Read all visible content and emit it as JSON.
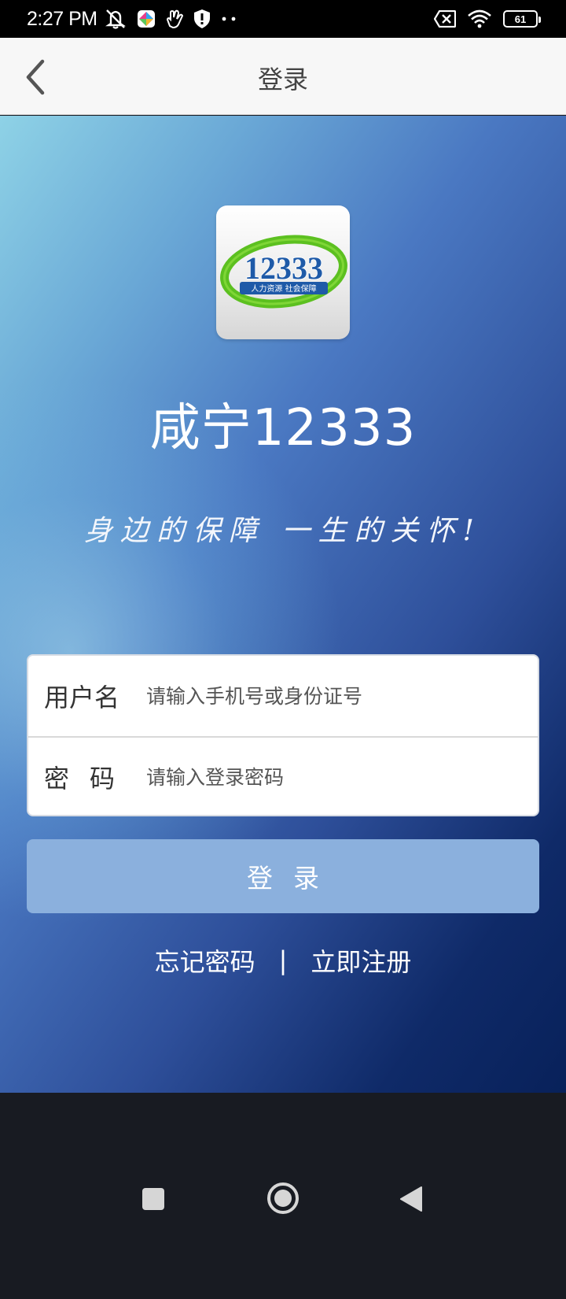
{
  "status_bar": {
    "time": "2:27 PM",
    "battery_level": "61",
    "icons": [
      "mute-icon",
      "app-notification-icon",
      "hand-icon",
      "shield-icon",
      "more-dots-icon",
      "sim-error-icon",
      "wifi-icon",
      "battery-icon"
    ]
  },
  "app_bar": {
    "title": "登录",
    "back_icon": "chevron-left-icon"
  },
  "hero": {
    "logo": {
      "number": "12333",
      "subtitle": "人力资源 社会保障"
    },
    "app_name": "咸宁12333",
    "slogan": "身边的保障 一生的关怀!"
  },
  "form": {
    "username_label": "用户名",
    "username_placeholder": "请输入手机号或身份证号",
    "password_label": "密码",
    "password_placeholder": "请输入登录密码"
  },
  "login_button": "登录",
  "links": {
    "forgot": "忘记密码",
    "separator": "|",
    "register": "立即注册"
  },
  "nav_bar": {
    "icons": [
      "recents-icon",
      "home-icon",
      "back-icon"
    ]
  },
  "colors": {
    "login_button": "#8bb0dd",
    "app_bar": "#f7f7f7",
    "gradient_start": "#8ed2e6",
    "gradient_end": "#08215a",
    "logo_green": "#5cc020",
    "logo_blue": "#1e5aa8"
  }
}
